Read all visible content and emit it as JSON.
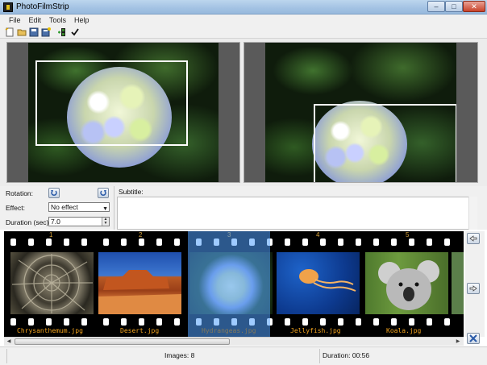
{
  "window": {
    "title": "PhotoFilmStrip",
    "controls": {
      "minimize": "–",
      "maximize": "□",
      "close": "✕"
    }
  },
  "menu": [
    "File",
    "Edit",
    "Tools",
    "Help"
  ],
  "toolbar": {
    "icons": [
      "new-project-icon",
      "open-project-icon",
      "save-project-icon",
      "save-as-icon",
      "import-pictures-icon",
      "render-checkmark-icon"
    ]
  },
  "controls": {
    "rotation_label": "Rotation:",
    "effect_label": "Effect:",
    "effect_value": "No effect",
    "duration_label": "Duration (sec):",
    "duration_value": "7.0",
    "subtitle_label": "Subtitle:",
    "subtitle_value": ""
  },
  "filmstrip": {
    "frame_numbers": [
      "1",
      "2",
      "3",
      "4",
      "5"
    ],
    "items": [
      {
        "name": "Chrysanthemum.jpg"
      },
      {
        "name": "Desert.jpg"
      },
      {
        "name": "Hydrangeas.jpg",
        "selected": true
      },
      {
        "name": "Jellyfish.jpg"
      },
      {
        "name": "Koala.jpg"
      }
    ]
  },
  "status": {
    "images": "Images: 8",
    "duration": "Duration: 00:56"
  },
  "colors": {
    "film_label": "#f0a21e",
    "selection": "#50a0ff"
  }
}
